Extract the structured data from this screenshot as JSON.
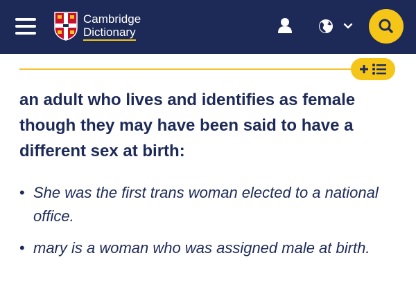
{
  "header": {
    "logo_line1": "Cambridge",
    "logo_line2": "Dictionary",
    "icons": {
      "menu": "hamburger-menu-icon",
      "user": "user-icon",
      "language": "globe-icon",
      "dropdown": "chevron-down-icon",
      "search": "search-icon"
    },
    "colors": {
      "header_bg": "#1d2a57",
      "accent": "#f5c518"
    }
  },
  "wordlist_button": {
    "icons": [
      "plus-icon",
      "list-icon"
    ]
  },
  "entry": {
    "definition": "an adult who lives and identifies as female though they may have been said to have a different sex at birth:",
    "examples": [
      "She was the first trans woman elected to a national office.",
      "mary is a woman who was assigned male at birth."
    ]
  }
}
